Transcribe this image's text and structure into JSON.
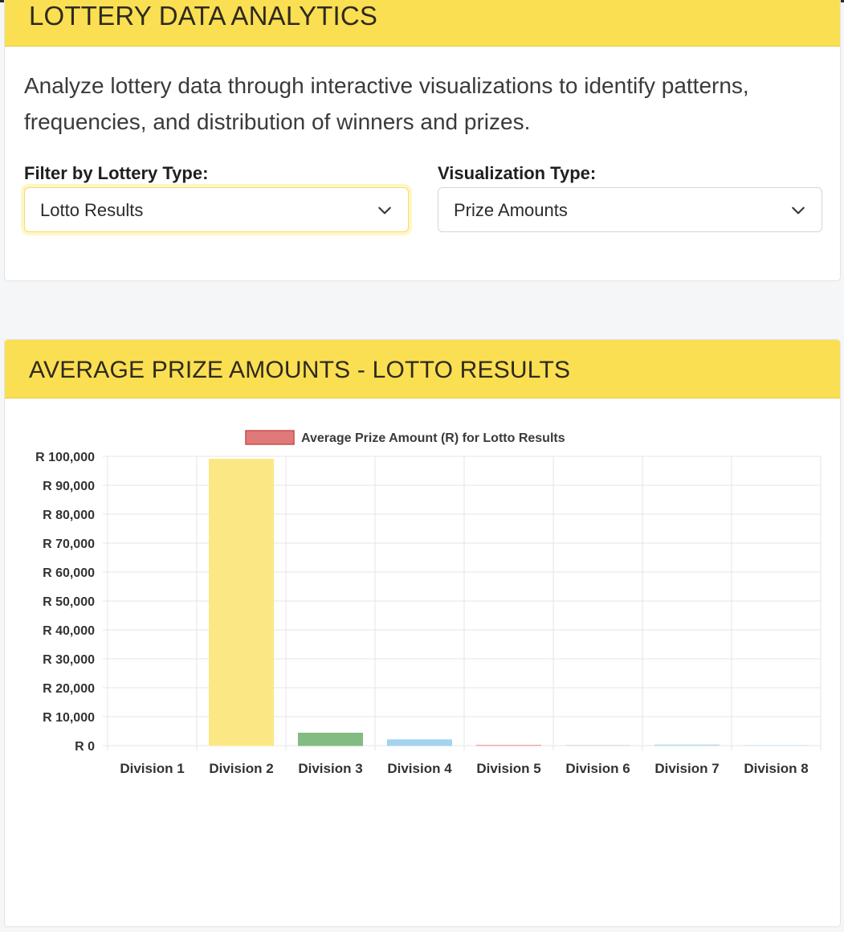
{
  "app": {
    "title": "LOTTERY DATA ANALYTICS",
    "description": "Analyze lottery data through interactive visualizations to identify patterns, frequencies, and distribution of winners and prizes."
  },
  "filters": {
    "lottery_type_label": "Filter by Lottery Type:",
    "lottery_type_value": "Lotto Results",
    "visualization_label": "Visualization Type:",
    "visualization_value": "Prize Amounts"
  },
  "chart_panel": {
    "title": "AVERAGE PRIZE AMOUNTS - LOTTO RESULTS"
  },
  "colors": {
    "header_yellow": "#fbdf52",
    "legend_fill": "#e07a7a",
    "legend_stroke": "#cc4b4b"
  },
  "chart_data": {
    "type": "bar",
    "legend": "Average Prize Amount (R) for Lotto Results",
    "legend_position": "top",
    "categories": [
      "Division 1",
      "Division 2",
      "Division 3",
      "Division 4",
      "Division 5",
      "Division 6",
      "Division 7",
      "Division 8"
    ],
    "values": [
      0,
      99000,
      4300,
      2000,
      150,
      60,
      250,
      100
    ],
    "colors": [
      "#f28e8e",
      "#fbe77e",
      "#7cb87c",
      "#9fd1ef",
      "#f2a8a8",
      "#d8d8d8",
      "#bcdcec",
      "#cfe6f3"
    ],
    "ylim": [
      0,
      100000
    ],
    "yticks": [
      "R 0",
      "R 10,000",
      "R 20,000",
      "R 30,000",
      "R 40,000",
      "R 50,000",
      "R 60,000",
      "R 70,000",
      "R 80,000",
      "R 90,000",
      "R 100,000"
    ],
    "grid": true
  }
}
